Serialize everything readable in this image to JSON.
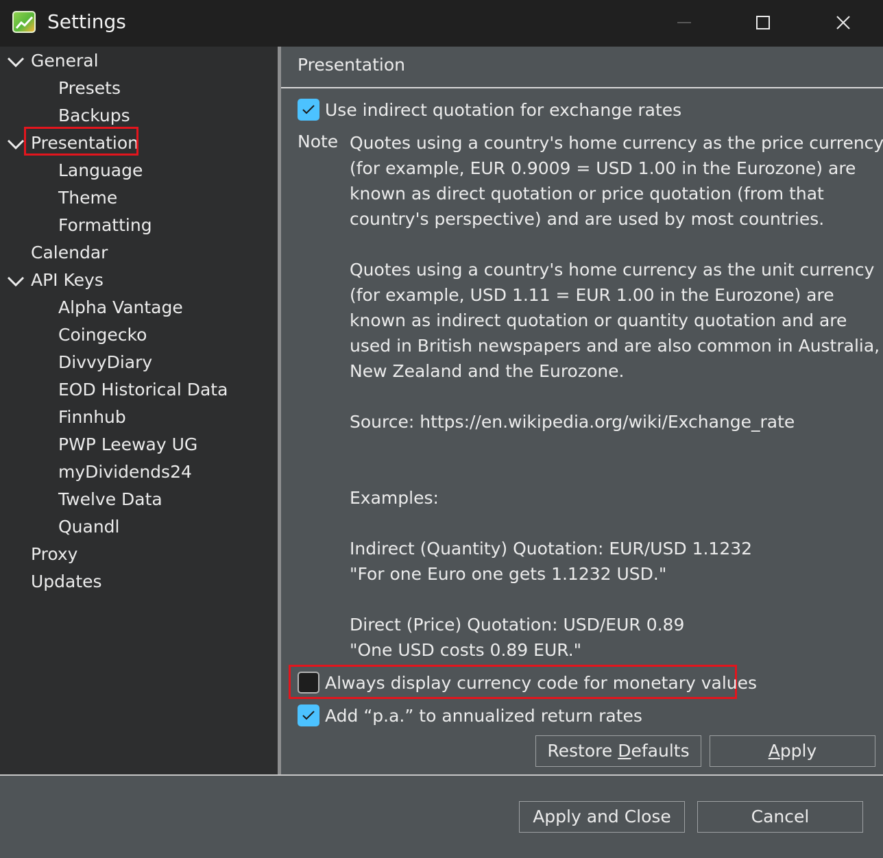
{
  "window": {
    "title": "Settings",
    "minimize_icon": "minimize-icon",
    "maximize_icon": "maximize-icon",
    "close_icon": "close-icon"
  },
  "sidebar": {
    "items": [
      {
        "label": "General",
        "level": 0,
        "expanded": true
      },
      {
        "label": "Presets",
        "level": 1
      },
      {
        "label": "Backups",
        "level": 1
      },
      {
        "label": "Presentation",
        "level": 0,
        "expanded": true,
        "selected": true
      },
      {
        "label": "Language",
        "level": 1
      },
      {
        "label": "Theme",
        "level": 1
      },
      {
        "label": "Formatting",
        "level": 1
      },
      {
        "label": "Calendar",
        "level": 0
      },
      {
        "label": "API Keys",
        "level": 0,
        "expanded": true
      },
      {
        "label": "Alpha Vantage",
        "level": 1
      },
      {
        "label": "Coingecko",
        "level": 1
      },
      {
        "label": "DivvyDiary",
        "level": 1
      },
      {
        "label": "EOD Historical Data",
        "level": 1
      },
      {
        "label": "Finnhub",
        "level": 1
      },
      {
        "label": "PWP Leeway UG",
        "level": 1
      },
      {
        "label": "myDividends24",
        "level": 1
      },
      {
        "label": "Twelve Data",
        "level": 1
      },
      {
        "label": "Quandl",
        "level": 1
      },
      {
        "label": "Proxy",
        "level": 0
      },
      {
        "label": "Updates",
        "level": 0
      }
    ]
  },
  "panel": {
    "title": "Presentation",
    "indirect_quotation": {
      "label": "Use indirect quotation for exchange rates",
      "checked": true
    },
    "note_label": "Note",
    "note_lines": [
      "Quotes using a country's home currency as the price currency",
      "(for example, EUR 0.9009 = USD 1.00 in the Eurozone) are",
      "known as direct quotation or price quotation (from that",
      "country's perspective) and are used by most countries.",
      "",
      "Quotes using a country's home currency as the unit currency",
      "(for example, USD 1.11 = EUR 1.00 in the Eurozone) are",
      "known as indirect quotation or quantity quotation and are",
      "used in British newspapers and are also common in Australia,",
      "New Zealand and the Eurozone.",
      "",
      "Source: https://en.wikipedia.org/wiki/Exchange_rate",
      "",
      "",
      "Examples:",
      "",
      "Indirect (Quantity) Quotation: EUR/USD 1.1232",
      "\"For one Euro one gets 1.1232 USD.\"",
      "",
      "Direct (Price) Quotation: USD/EUR 0.89",
      "\"One USD costs 0.89 EUR.\""
    ],
    "currency_code": {
      "label": "Always display currency code for monetary values",
      "checked": false
    },
    "pa_suffix": {
      "label": "Add “p.a.” to annualized return rates",
      "checked": true
    },
    "restore_defaults": {
      "pre": "Restore ",
      "mnemonic": "D",
      "post": "efaults"
    },
    "apply": {
      "pre": "",
      "mnemonic": "A",
      "post": "pply"
    }
  },
  "footer": {
    "apply_and_close": "Apply and Close",
    "cancel": "Cancel"
  },
  "colors": {
    "accent": "#4cc2ff",
    "highlight_box": "#e3151d",
    "panel_bg": "#4f5457",
    "sidebar_bg": "#2d2e2f"
  }
}
